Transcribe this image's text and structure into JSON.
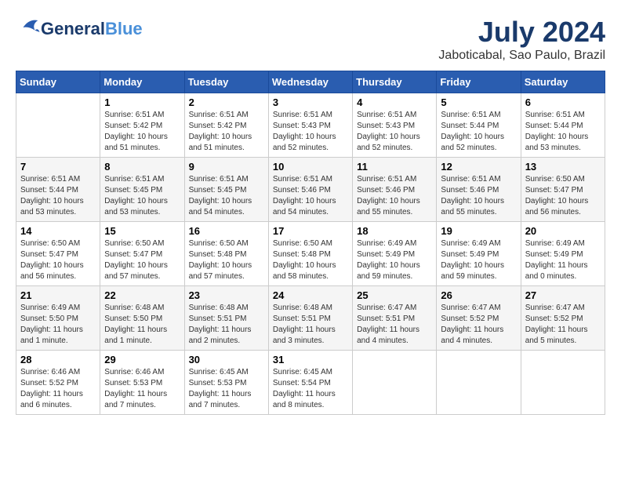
{
  "header": {
    "logo_line1": "General",
    "logo_line2": "Blue",
    "month_title": "July 2024",
    "location": "Jaboticabal, Sao Paulo, Brazil"
  },
  "days_of_week": [
    "Sunday",
    "Monday",
    "Tuesday",
    "Wednesday",
    "Thursday",
    "Friday",
    "Saturday"
  ],
  "weeks": [
    [
      {
        "day": "",
        "info": ""
      },
      {
        "day": "1",
        "info": "Sunrise: 6:51 AM\nSunset: 5:42 PM\nDaylight: 10 hours\nand 51 minutes."
      },
      {
        "day": "2",
        "info": "Sunrise: 6:51 AM\nSunset: 5:42 PM\nDaylight: 10 hours\nand 51 minutes."
      },
      {
        "day": "3",
        "info": "Sunrise: 6:51 AM\nSunset: 5:43 PM\nDaylight: 10 hours\nand 52 minutes."
      },
      {
        "day": "4",
        "info": "Sunrise: 6:51 AM\nSunset: 5:43 PM\nDaylight: 10 hours\nand 52 minutes."
      },
      {
        "day": "5",
        "info": "Sunrise: 6:51 AM\nSunset: 5:44 PM\nDaylight: 10 hours\nand 52 minutes."
      },
      {
        "day": "6",
        "info": "Sunrise: 6:51 AM\nSunset: 5:44 PM\nDaylight: 10 hours\nand 53 minutes."
      }
    ],
    [
      {
        "day": "7",
        "info": "Sunrise: 6:51 AM\nSunset: 5:44 PM\nDaylight: 10 hours\nand 53 minutes."
      },
      {
        "day": "8",
        "info": "Sunrise: 6:51 AM\nSunset: 5:45 PM\nDaylight: 10 hours\nand 53 minutes."
      },
      {
        "day": "9",
        "info": "Sunrise: 6:51 AM\nSunset: 5:45 PM\nDaylight: 10 hours\nand 54 minutes."
      },
      {
        "day": "10",
        "info": "Sunrise: 6:51 AM\nSunset: 5:46 PM\nDaylight: 10 hours\nand 54 minutes."
      },
      {
        "day": "11",
        "info": "Sunrise: 6:51 AM\nSunset: 5:46 PM\nDaylight: 10 hours\nand 55 minutes."
      },
      {
        "day": "12",
        "info": "Sunrise: 6:51 AM\nSunset: 5:46 PM\nDaylight: 10 hours\nand 55 minutes."
      },
      {
        "day": "13",
        "info": "Sunrise: 6:50 AM\nSunset: 5:47 PM\nDaylight: 10 hours\nand 56 minutes."
      }
    ],
    [
      {
        "day": "14",
        "info": "Sunrise: 6:50 AM\nSunset: 5:47 PM\nDaylight: 10 hours\nand 56 minutes."
      },
      {
        "day": "15",
        "info": "Sunrise: 6:50 AM\nSunset: 5:47 PM\nDaylight: 10 hours\nand 57 minutes."
      },
      {
        "day": "16",
        "info": "Sunrise: 6:50 AM\nSunset: 5:48 PM\nDaylight: 10 hours\nand 57 minutes."
      },
      {
        "day": "17",
        "info": "Sunrise: 6:50 AM\nSunset: 5:48 PM\nDaylight: 10 hours\nand 58 minutes."
      },
      {
        "day": "18",
        "info": "Sunrise: 6:49 AM\nSunset: 5:49 PM\nDaylight: 10 hours\nand 59 minutes."
      },
      {
        "day": "19",
        "info": "Sunrise: 6:49 AM\nSunset: 5:49 PM\nDaylight: 10 hours\nand 59 minutes."
      },
      {
        "day": "20",
        "info": "Sunrise: 6:49 AM\nSunset: 5:49 PM\nDaylight: 11 hours\nand 0 minutes."
      }
    ],
    [
      {
        "day": "21",
        "info": "Sunrise: 6:49 AM\nSunset: 5:50 PM\nDaylight: 11 hours\nand 1 minute."
      },
      {
        "day": "22",
        "info": "Sunrise: 6:48 AM\nSunset: 5:50 PM\nDaylight: 11 hours\nand 1 minute."
      },
      {
        "day": "23",
        "info": "Sunrise: 6:48 AM\nSunset: 5:51 PM\nDaylight: 11 hours\nand 2 minutes."
      },
      {
        "day": "24",
        "info": "Sunrise: 6:48 AM\nSunset: 5:51 PM\nDaylight: 11 hours\nand 3 minutes."
      },
      {
        "day": "25",
        "info": "Sunrise: 6:47 AM\nSunset: 5:51 PM\nDaylight: 11 hours\nand 4 minutes."
      },
      {
        "day": "26",
        "info": "Sunrise: 6:47 AM\nSunset: 5:52 PM\nDaylight: 11 hours\nand 4 minutes."
      },
      {
        "day": "27",
        "info": "Sunrise: 6:47 AM\nSunset: 5:52 PM\nDaylight: 11 hours\nand 5 minutes."
      }
    ],
    [
      {
        "day": "28",
        "info": "Sunrise: 6:46 AM\nSunset: 5:52 PM\nDaylight: 11 hours\nand 6 minutes."
      },
      {
        "day": "29",
        "info": "Sunrise: 6:46 AM\nSunset: 5:53 PM\nDaylight: 11 hours\nand 7 minutes."
      },
      {
        "day": "30",
        "info": "Sunrise: 6:45 AM\nSunset: 5:53 PM\nDaylight: 11 hours\nand 7 minutes."
      },
      {
        "day": "31",
        "info": "Sunrise: 6:45 AM\nSunset: 5:54 PM\nDaylight: 11 hours\nand 8 minutes."
      },
      {
        "day": "",
        "info": ""
      },
      {
        "day": "",
        "info": ""
      },
      {
        "day": "",
        "info": ""
      }
    ]
  ]
}
